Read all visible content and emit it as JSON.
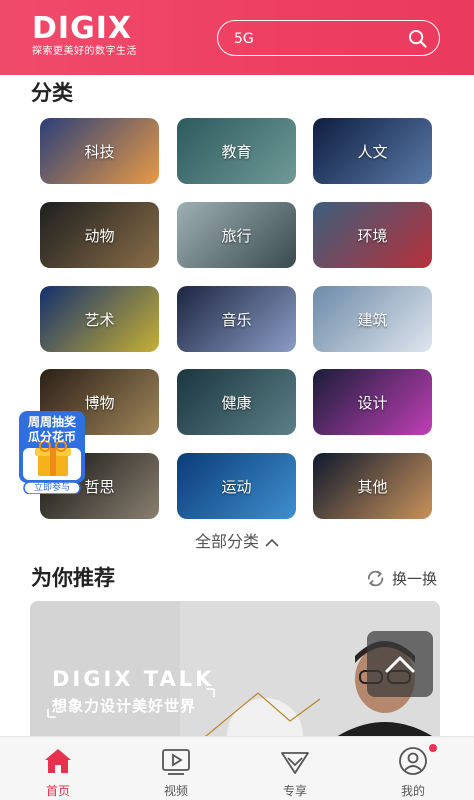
{
  "header": {
    "logo_text": "DIGIX",
    "logo_tagline": "探索更美好的数字生活",
    "search_value": "5G",
    "brand_color": "#ee3f62"
  },
  "categories": {
    "title": "分类",
    "items": [
      {
        "label": "科技",
        "colors": [
          "#2b3f7a",
          "#e89a45"
        ]
      },
      {
        "label": "教育",
        "colors": [
          "#2d5a5e",
          "#6f9a96"
        ]
      },
      {
        "label": "人文",
        "colors": [
          "#0e1e40",
          "#5a7aa8"
        ]
      },
      {
        "label": "动物",
        "colors": [
          "#1d1f1f",
          "#8a6d47"
        ]
      },
      {
        "label": "旅行",
        "colors": [
          "#9fb0b4",
          "#3a4b50"
        ]
      },
      {
        "label": "环境",
        "colors": [
          "#3c5f7d",
          "#b8303a"
        ]
      },
      {
        "label": "艺术",
        "colors": [
          "#14306e",
          "#c7b035"
        ]
      },
      {
        "label": "音乐",
        "colors": [
          "#1c2640",
          "#8b9cc6"
        ]
      },
      {
        "label": "建筑",
        "colors": [
          "#6c8aa8",
          "#dfe6ee"
        ]
      },
      {
        "label": "博物",
        "colors": [
          "#2b1f17",
          "#a08659"
        ]
      },
      {
        "label": "健康",
        "colors": [
          "#1b3640",
          "#5c7f86"
        ]
      },
      {
        "label": "设计",
        "colors": [
          "#1a1d38",
          "#c03fb6"
        ]
      },
      {
        "label": "哲思",
        "colors": [
          "#141414",
          "#8a8070"
        ]
      },
      {
        "label": "运动",
        "colors": [
          "#0b3c78",
          "#3f8fcf"
        ]
      },
      {
        "label": "其他",
        "colors": [
          "#0f1a2e",
          "#c9925a"
        ]
      }
    ],
    "all_label": "全部分类"
  },
  "recommend": {
    "title": "为你推荐",
    "refresh_label": "换一换",
    "banner_title": "DIGIX TALK",
    "banner_subtitle": "想象力设计美好世界"
  },
  "promo": {
    "line1": "周周抽奖",
    "line2": "瓜分花币",
    "cta": "立即参与"
  },
  "tabbar": {
    "items": [
      {
        "label": "首页",
        "icon": "home-icon",
        "active": true
      },
      {
        "label": "视频",
        "icon": "video-icon",
        "active": false
      },
      {
        "label": "专享",
        "icon": "diamond-icon",
        "active": false
      },
      {
        "label": "我的",
        "icon": "user-icon",
        "active": false
      }
    ],
    "active_color": "#e8304f"
  }
}
